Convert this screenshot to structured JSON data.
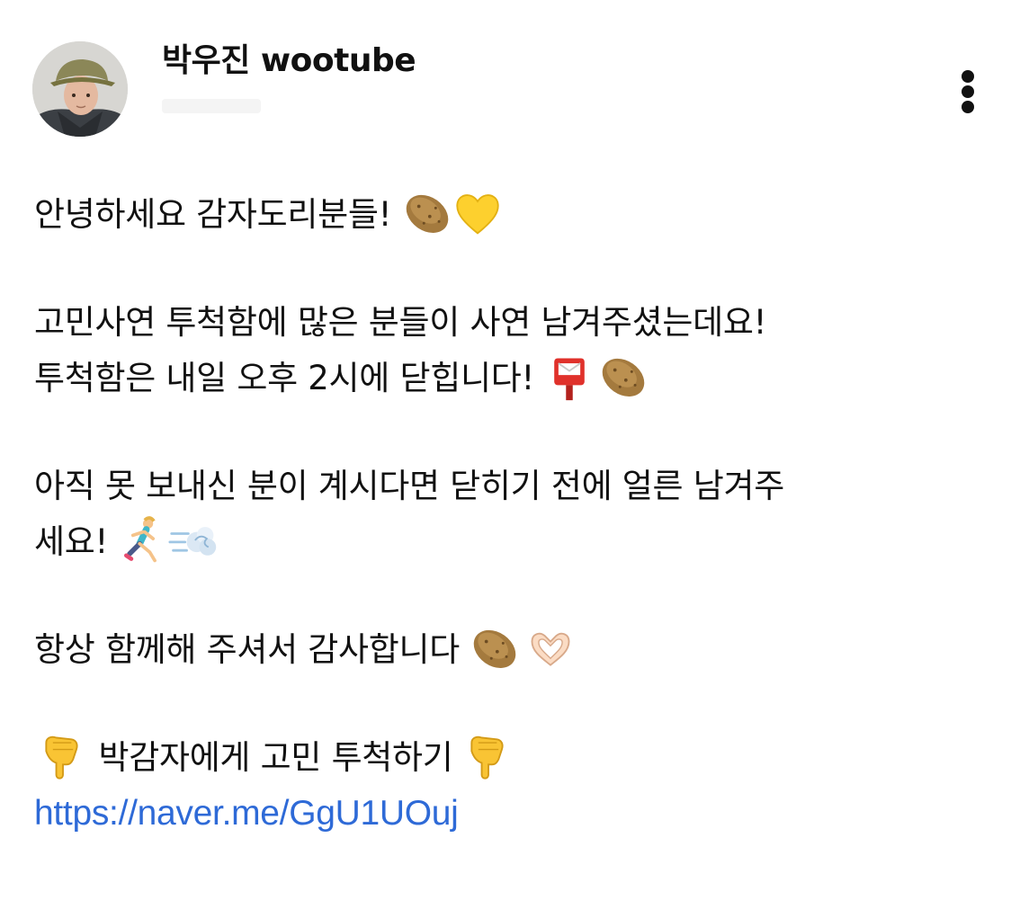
{
  "author": {
    "name": "박우진 wootube"
  },
  "post": {
    "line1": "안녕하세요 감자도리분들!",
    "line2": "고민사연 투척함에 많은 분들이 사연 남겨주셨는데요!",
    "line3": "투척함은 내일 오후 2시에 닫힙니다!",
    "line4": "아직 못 보내신 분이 계시다면 닫히기 전에 얼른 남겨주",
    "line5": "세요!",
    "line6": "항상 함께해 주셔서 감사합니다",
    "line7": "박감자에게 고민 투척하기",
    "link": "https://naver.me/GgU1UOuj"
  },
  "icons": {
    "more": "more-vertical-icon",
    "emojis": [
      "potato",
      "yellow-heart",
      "postbox",
      "potato",
      "woman-running",
      "dash",
      "potato",
      "heart-hands",
      "backhand-index-pointing-down",
      "backhand-index-pointing-down"
    ]
  },
  "colors": {
    "link": "#2e6ad7",
    "text": "#111111",
    "background": "#ffffff"
  }
}
